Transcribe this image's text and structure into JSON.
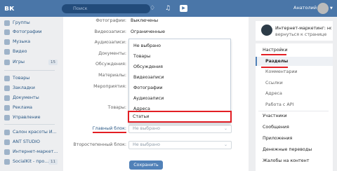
{
  "header": {
    "logo": "вк",
    "search_placeholder": "Поиск",
    "user_name": "Анатолий",
    "icons": [
      "bell-icon",
      "music-icon",
      "play-icon"
    ]
  },
  "sidebar": {
    "items": [
      {
        "label": "Группы",
        "icon": "groups-icon"
      },
      {
        "label": "Фотографии",
        "icon": "photos-icon"
      },
      {
        "label": "Музыка",
        "icon": "music-icon"
      },
      {
        "label": "Видео",
        "icon": "video-icon"
      },
      {
        "label": "Игры",
        "icon": "games-icon",
        "count": "15"
      },
      {
        "label": "Товары",
        "icon": "goods-icon"
      },
      {
        "label": "Закладки",
        "icon": "bookmarks-icon"
      },
      {
        "label": "Документы",
        "icon": "documents-icon"
      },
      {
        "label": "Реклама",
        "icon": "ads-icon"
      },
      {
        "label": "Управление",
        "icon": "manage-icon"
      },
      {
        "label": "Салон красоты И...",
        "icon": "group-icon"
      },
      {
        "label": "ANT STUDIO",
        "icon": "group-icon"
      },
      {
        "label": "Интернет-маркет...",
        "icon": "group-icon"
      },
      {
        "label": "SocialKit - про...",
        "icon": "group-icon",
        "count": "11"
      }
    ]
  },
  "settings": {
    "rows": [
      {
        "label": "Фотографии:",
        "value": "Выключены"
      },
      {
        "label": "Видеозаписи:",
        "value": "Ограниченные"
      },
      {
        "label": "Аудиозаписи:",
        "value": ""
      },
      {
        "label": "Документы:",
        "value": ""
      },
      {
        "label": "Обсуждения:",
        "value": ""
      },
      {
        "label": "Материалы:",
        "value": ""
      },
      {
        "label": "Мероприятия:",
        "value": ""
      },
      {
        "label": "Товары:",
        "value": ""
      }
    ],
    "main_block_label": "Главный блок:",
    "main_block_value": "Не выбрано",
    "secondary_block_label": "Второстепенный блок:",
    "secondary_block_value": "Не выбрано",
    "save_label": "Сохранить"
  },
  "dropdown": {
    "options": [
      "Не выбрано",
      "Товары",
      "Обсуждения",
      "Видеозаписи",
      "Фотографии",
      "Аудиозаписи",
      "Адреса",
      "Статьи"
    ],
    "highlighted": "Статьи"
  },
  "right_menu": {
    "community_name": "Интернет-маркетинг: но...",
    "back_label": "вернуться к странице",
    "settings": "Настройки",
    "active": "Разделы",
    "sub_items": [
      "Комментарии",
      "Ссылки",
      "Адреса",
      "Работа с API"
    ],
    "items": [
      "Участники",
      "Сообщения",
      "Приложения",
      "Денежные переводы",
      "Жалобы на контент"
    ]
  },
  "colors": {
    "brand": "#4a76a8",
    "highlight": "#e31e24",
    "button": "#5181b8"
  }
}
